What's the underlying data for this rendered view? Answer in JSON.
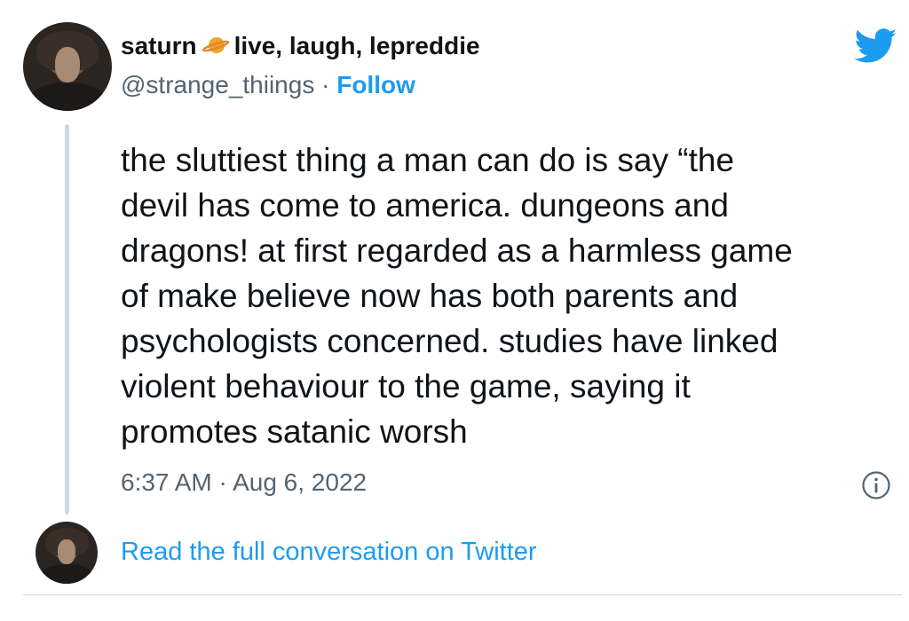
{
  "author": {
    "display_name_before": "saturn",
    "display_name_after": "live, laugh, lepreddie",
    "handle": "@strange_thiings",
    "separator": "·",
    "follow_label": "Follow"
  },
  "tweet": {
    "lines": [
      "the sluttiest thing a man can do is say “the",
      "devil has come to america. dungeons and",
      "dragons! at first regarded as a harmless game",
      "of make believe now has both parents and",
      "psychologists concerned. studies have linked",
      "violent behaviour to the game, saying it",
      "promotes satanic worsh"
    ],
    "timestamp": "6:37 AM · Aug 6, 2022"
  },
  "footer": {
    "read_full_label": "Read the full conversation on Twitter"
  },
  "icons": {
    "brand": "twitter-bird-icon",
    "emoji": "ringed-planet-icon",
    "info": "info-icon"
  },
  "colors": {
    "accent": "#1d9bf0",
    "secondary_text": "#536471",
    "primary_text": "#0f1419"
  }
}
